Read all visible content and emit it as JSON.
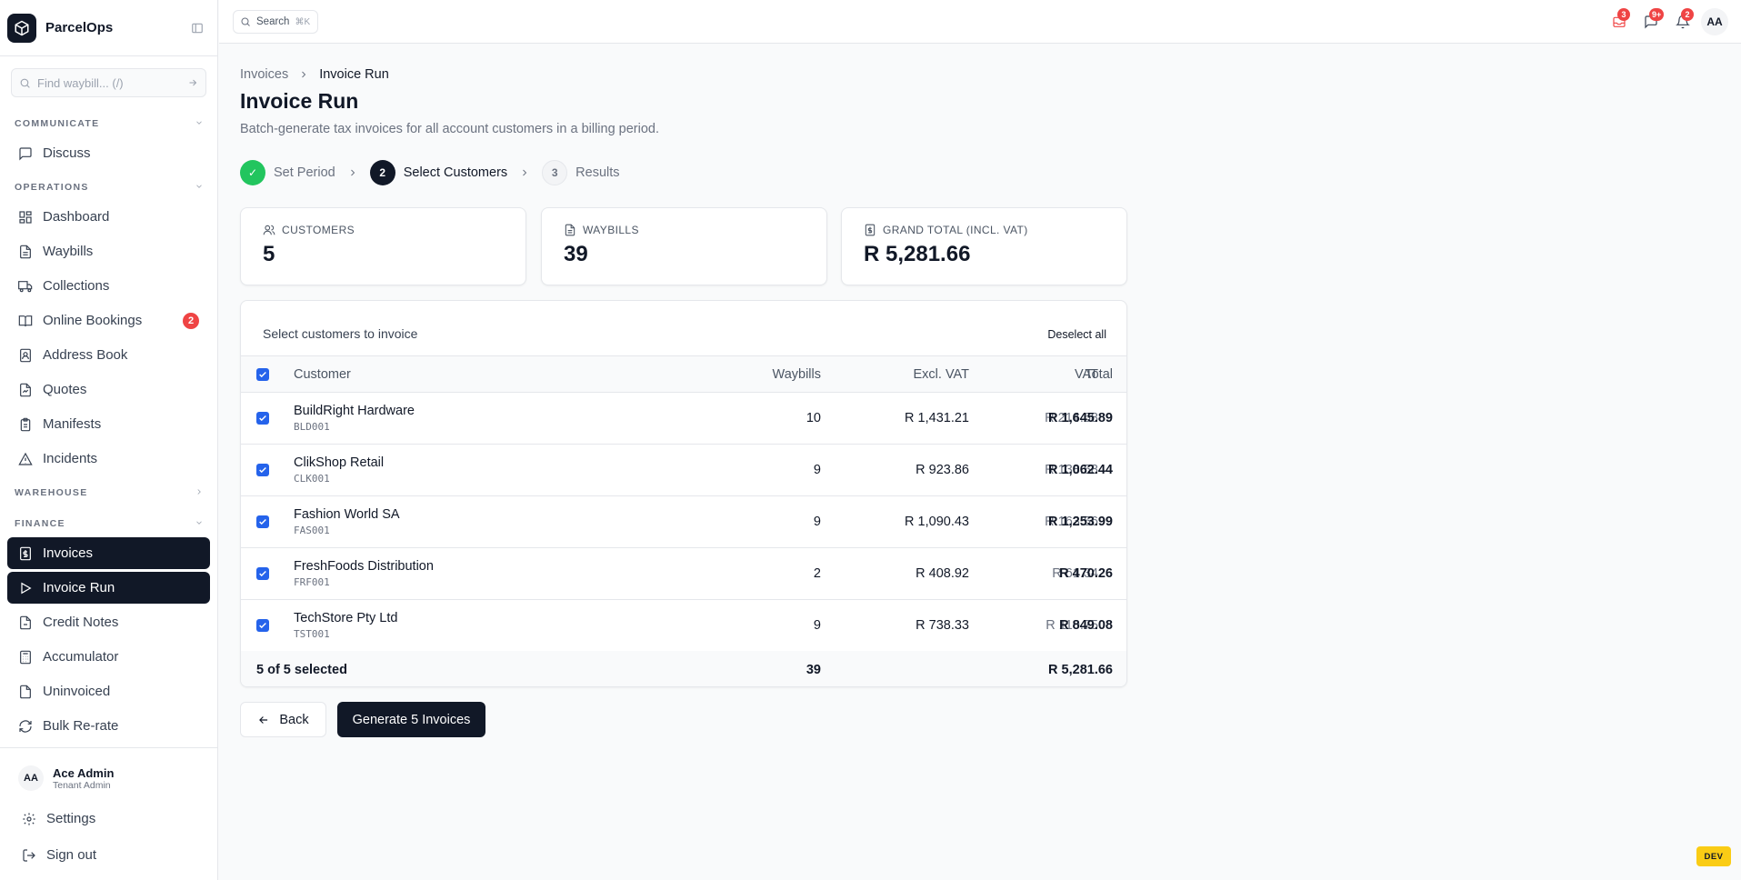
{
  "brand": {
    "name": "ParcelOps"
  },
  "sidebar": {
    "search_placeholder": "Find waybill... (/)",
    "sections": {
      "communicate": "COMMUNICATE",
      "operations": "OPERATIONS",
      "warehouse": "WAREHOUSE",
      "finance": "FINANCE"
    },
    "items": {
      "discuss": "Discuss",
      "dashboard": "Dashboard",
      "waybills": "Waybills",
      "collections": "Collections",
      "online_bookings": "Online Bookings",
      "online_bookings_badge": "2",
      "address_book": "Address Book",
      "quotes": "Quotes",
      "manifests": "Manifests",
      "incidents": "Incidents",
      "invoices": "Invoices",
      "invoice_run": "Invoice Run",
      "credit_notes": "Credit Notes",
      "accumulator": "Accumulator",
      "uninvoiced": "Uninvoiced",
      "bulk_rerate": "Bulk Re-rate"
    },
    "user": {
      "initials": "AA",
      "name": "Ace Admin",
      "role": "Tenant Admin"
    },
    "settings": "Settings",
    "sign_out": "Sign out"
  },
  "topbar": {
    "search_label": "Search",
    "search_kbd": "⌘K",
    "badges": {
      "inbox": "3",
      "messages": "9+",
      "notifications": "2"
    },
    "avatar": "AA"
  },
  "breadcrumb": {
    "parent": "Invoices",
    "current": "Invoice Run"
  },
  "page": {
    "title": "Invoice Run",
    "subtitle": "Batch-generate tax invoices for all account customers in a billing period."
  },
  "steps": [
    {
      "num": "✓",
      "label": "Set Period",
      "state": "done"
    },
    {
      "num": "2",
      "label": "Select Customers",
      "state": "current"
    },
    {
      "num": "3",
      "label": "Results",
      "state": "todo"
    }
  ],
  "stats": {
    "customers": {
      "label": "CUSTOMERS",
      "value": "5"
    },
    "waybills": {
      "label": "WAYBILLS",
      "value": "39"
    },
    "grand_total": {
      "label": "GRAND TOTAL (INCL. VAT)",
      "value": "R 5,281.66"
    }
  },
  "table": {
    "title": "Select customers to invoice",
    "deselect_label": "Deselect all",
    "headers": {
      "customer": "Customer",
      "waybills": "Waybills",
      "excl_vat": "Excl. VAT",
      "vat": "VAT",
      "total": "Total"
    },
    "rows": [
      {
        "name": "BuildRight Hardware",
        "code": "BLD001",
        "waybills": "10",
        "excl_vat": "R 1,431.21",
        "vat": "R 214.68",
        "total": "R 1,645.89",
        "selected": true
      },
      {
        "name": "ClikShop Retail",
        "code": "CLK001",
        "waybills": "9",
        "excl_vat": "R 923.86",
        "vat": "R 138.58",
        "total": "R 1,062.44",
        "selected": true
      },
      {
        "name": "Fashion World SA",
        "code": "FAS001",
        "waybills": "9",
        "excl_vat": "R 1,090.43",
        "vat": "R 163.56",
        "total": "R 1,253.99",
        "selected": true
      },
      {
        "name": "FreshFoods Distribution",
        "code": "FRF001",
        "waybills": "2",
        "excl_vat": "R 408.92",
        "vat": "R 61.34",
        "total": "R 470.26",
        "selected": true
      },
      {
        "name": "TechStore Pty Ltd",
        "code": "TST001",
        "waybills": "9",
        "excl_vat": "R 738.33",
        "vat": "R 110.75",
        "total": "R 849.08",
        "selected": true
      }
    ],
    "footer": {
      "selected_text": "5 of 5 selected",
      "waybills": "39",
      "total": "R 5,281.66"
    }
  },
  "actions": {
    "back": "Back",
    "generate": "Generate 5 Invoices"
  },
  "env_badge": "DEV",
  "colors": {
    "primary": "#111827",
    "success": "#22c55e",
    "danger": "#ef4444",
    "checkbox": "#2563eb",
    "dev": "#facc15"
  }
}
